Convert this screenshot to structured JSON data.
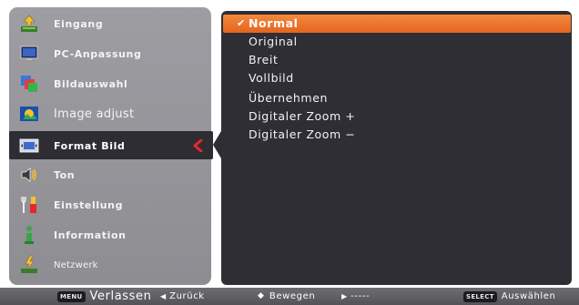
{
  "menu": {
    "items": [
      {
        "label": "Eingang",
        "icon": "input-icon",
        "style": "normal"
      },
      {
        "label": "PC-Anpassung",
        "icon": "pc-monitor-icon",
        "style": "normal"
      },
      {
        "label": "Bildauswahl",
        "icon": "image-select-icon",
        "style": "normal"
      },
      {
        "label": "Image adjust",
        "icon": "image-adjust-icon",
        "style": "big"
      },
      {
        "label": "Format Bild",
        "icon": "format-screen-icon",
        "style": "normal",
        "selected": true
      },
      {
        "label": "Ton",
        "icon": "speaker-icon",
        "style": "normal"
      },
      {
        "label": "Einstellung",
        "icon": "tools-icon",
        "style": "normal"
      },
      {
        "label": "Information",
        "icon": "info-icon",
        "style": "normal"
      },
      {
        "label": "Netzwerk",
        "icon": "network-icon",
        "style": "small"
      }
    ]
  },
  "options": {
    "items": [
      {
        "label": "Normal",
        "checked": true,
        "active": true
      },
      {
        "label": "Original"
      },
      {
        "label": "Breit"
      },
      {
        "label": "Vollbild"
      },
      {
        "label": "Übernehmen"
      },
      {
        "label": "Digitaler Zoom +"
      },
      {
        "label": "Digitaler Zoom −"
      }
    ],
    "check_mark": "✔"
  },
  "bottom_bar": {
    "menu_key": "MENU",
    "exit_label": "Verlassen",
    "back_arrow": "◀",
    "back_label": "Zurück",
    "move_arrows": "◆",
    "move_label": "Bewegen",
    "next_arrow": "▶",
    "next_label": "-----",
    "select_key": "SELECT",
    "select_label": "Auswählen"
  },
  "colors": {
    "accent": "#e8702a",
    "selected_arrow": "#e8262a"
  }
}
